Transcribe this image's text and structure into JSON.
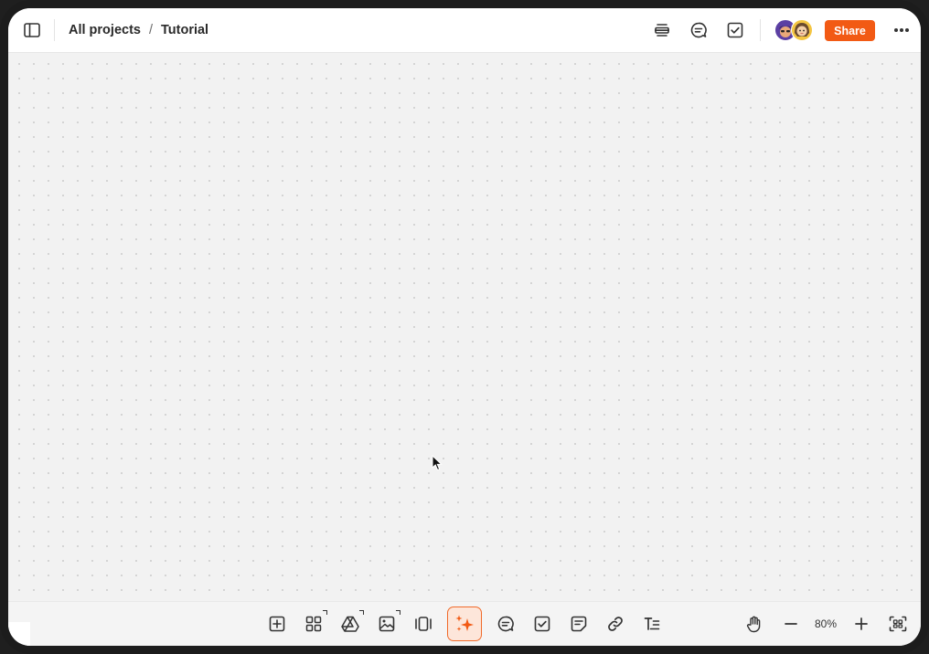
{
  "header": {
    "breadcrumb": {
      "root": "All projects",
      "separator": "/",
      "current": "Tutorial"
    },
    "share_label": "Share",
    "icons": [
      "sidebar-toggle-icon",
      "present-icon",
      "comments-icon",
      "tasks-icon",
      "more-icon"
    ]
  },
  "toolbar": {
    "zoom": "80%",
    "tools": [
      "add-block",
      "apps",
      "google-drive",
      "image",
      "carousel",
      "ai-assistant",
      "comment",
      "task",
      "note",
      "link",
      "text"
    ]
  },
  "colors": {
    "accent": "#f25a14",
    "ai_bg": "#fde6da",
    "canvas": "#f2f2f2"
  }
}
